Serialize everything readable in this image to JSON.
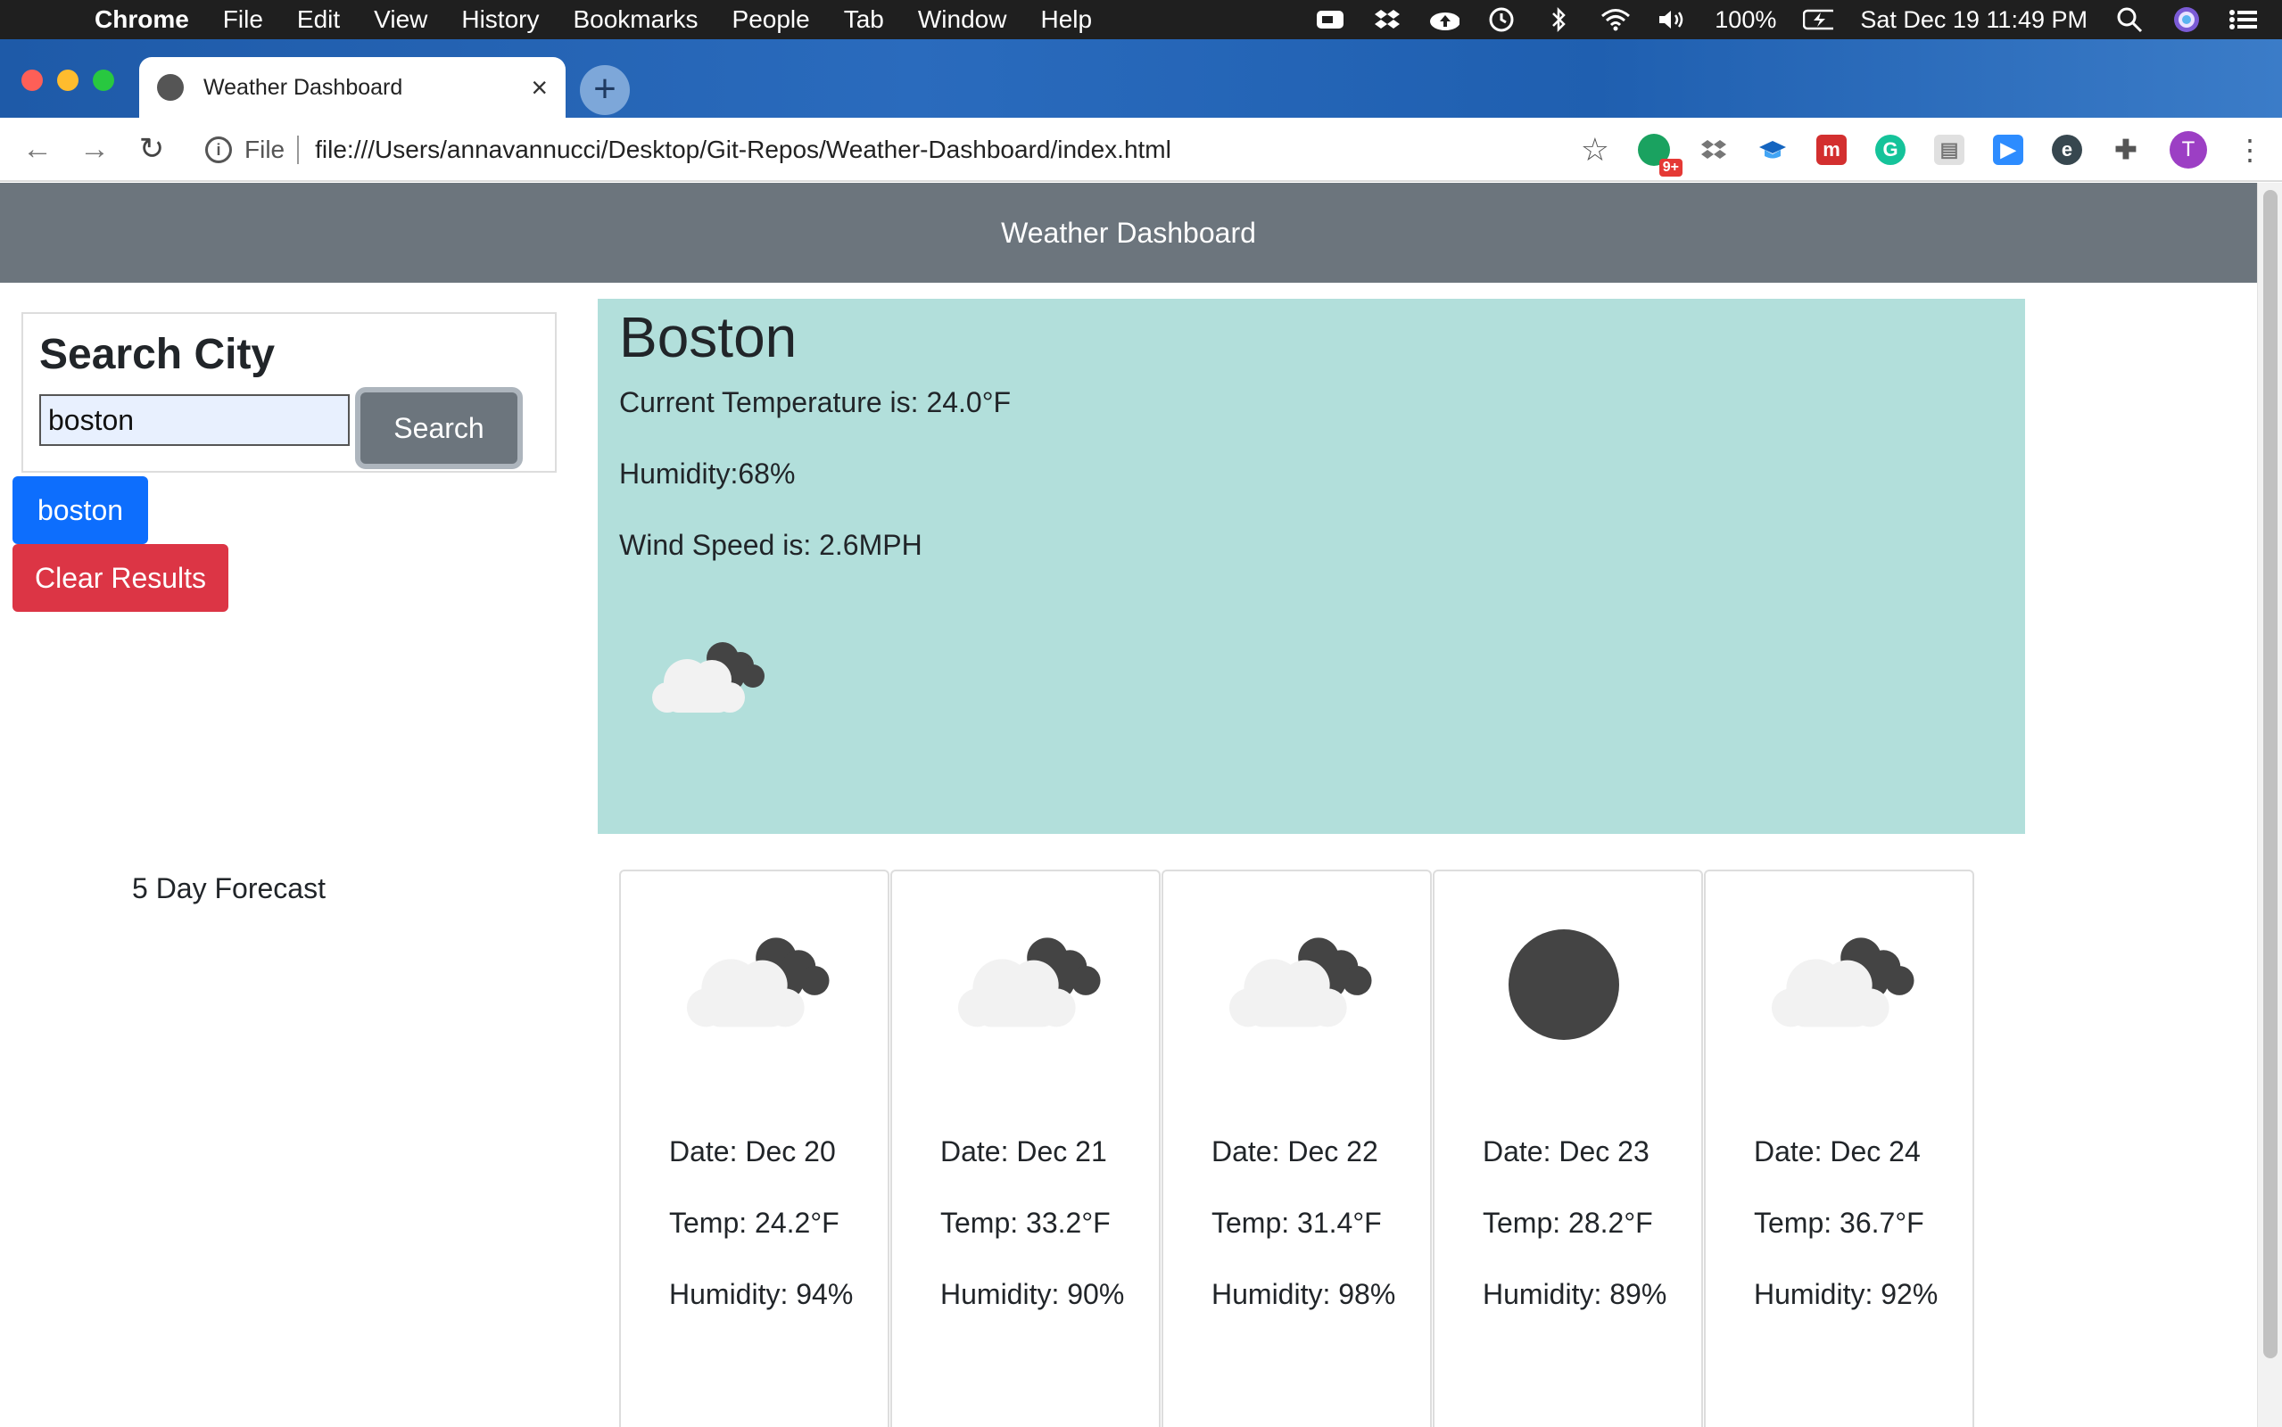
{
  "menubar": {
    "app": "Chrome",
    "items": [
      "File",
      "Edit",
      "View",
      "History",
      "Bookmarks",
      "People",
      "Tab",
      "Window",
      "Help"
    ],
    "battery": "100%",
    "datetime": "Sat Dec 19  11:49 PM"
  },
  "browser": {
    "tab_title": "Weather Dashboard",
    "file_label": "File",
    "url": "file:///Users/annavannucci/Desktop/Git-Repos/Weather-Dashboard/index.html",
    "ext_badge": "9+",
    "profile_initial": "T"
  },
  "page": {
    "header_title": "Weather Dashboard",
    "search": {
      "heading": "Search City",
      "input_value": "boston",
      "button_label": "Search"
    },
    "history": [
      "boston"
    ],
    "clear_label": "Clear Results",
    "current": {
      "city": "Boston",
      "temperature": "Current Temperature is: 24.0°F",
      "humidity": "Humidity:68%",
      "wind": "Wind Speed is: 2.6MPH",
      "icon": "partly-cloudy-night-icon"
    },
    "forecast_label": "5 Day Forecast",
    "forecast": [
      {
        "date": "Date: Dec 20",
        "temp": "Temp: 24.2°F",
        "humidity": "Humidity: 94%",
        "icon": "partly-cloudy-night-icon"
      },
      {
        "date": "Date: Dec 21",
        "temp": "Temp: 33.2°F",
        "humidity": "Humidity: 90%",
        "icon": "partly-cloudy-night-icon"
      },
      {
        "date": "Date: Dec 22",
        "temp": "Temp: 31.4°F",
        "humidity": "Humidity: 98%",
        "icon": "partly-cloudy-night-icon"
      },
      {
        "date": "Date: Dec 23",
        "temp": "Temp: 28.2°F",
        "humidity": "Humidity: 89%",
        "icon": "clear-night-icon"
      },
      {
        "date": "Date: Dec 24",
        "temp": "Temp: 36.7°F",
        "humidity": "Humidity: 92%",
        "icon": "partly-cloudy-night-icon"
      }
    ]
  }
}
